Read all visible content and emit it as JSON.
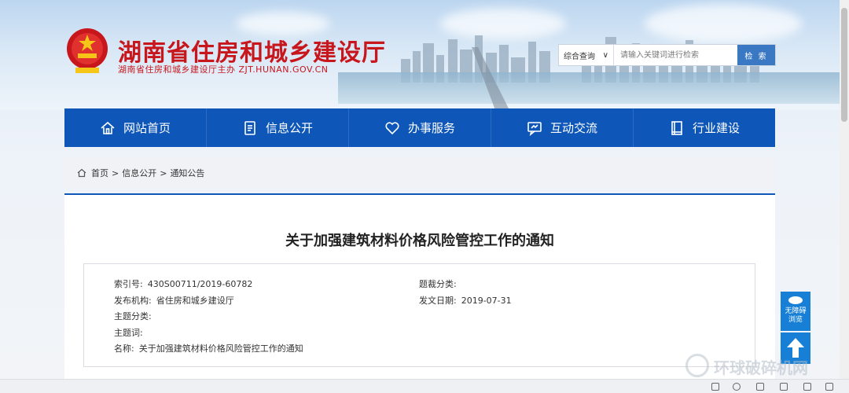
{
  "site": {
    "title": "湖南省住房和城乡建设厅",
    "subtitle": "湖南省住房和城乡建设厅主办  ZJT.HUNAN.GOV.CN"
  },
  "search": {
    "scope": "综合查询",
    "placeholder": "请输入关键词进行检索",
    "button": "检 索"
  },
  "nav": {
    "items": [
      {
        "label": "网站首页",
        "icon": "home-icon"
      },
      {
        "label": "信息公开",
        "icon": "document-icon"
      },
      {
        "label": "办事服务",
        "icon": "heart-icon"
      },
      {
        "label": "互动交流",
        "icon": "chat-icon"
      },
      {
        "label": "行业建设",
        "icon": "book-icon"
      }
    ]
  },
  "breadcrumb": {
    "items": [
      "首页",
      "信息公开",
      "通知公告"
    ],
    "separator": ">"
  },
  "article": {
    "title": "关于加强建筑材料价格风险管控工作的通知",
    "meta": {
      "index_label": "索引号:",
      "index_value": "430S00711/2019-60782",
      "category_label": "题裁分类:",
      "category_value": "",
      "publisher_label": "发布机构:",
      "publisher_value": "省住房和城乡建设厅",
      "date_label": "发文日期:",
      "date_value": "2019-07-31",
      "topic_label": "主题分类:",
      "topic_value": "",
      "keywords_label": "主题词:",
      "keywords_value": "",
      "name_label": "名称:",
      "name_value": "关于加强建筑材料价格风险管控工作的通知"
    }
  },
  "floating": {
    "accessibility": "无障碍浏览"
  },
  "watermark": "环球破碎机网",
  "colors": {
    "brand_red": "#c8161d",
    "nav_blue": "#0e57b8",
    "button_blue": "#3b78c4",
    "float_blue": "#1780d6"
  }
}
